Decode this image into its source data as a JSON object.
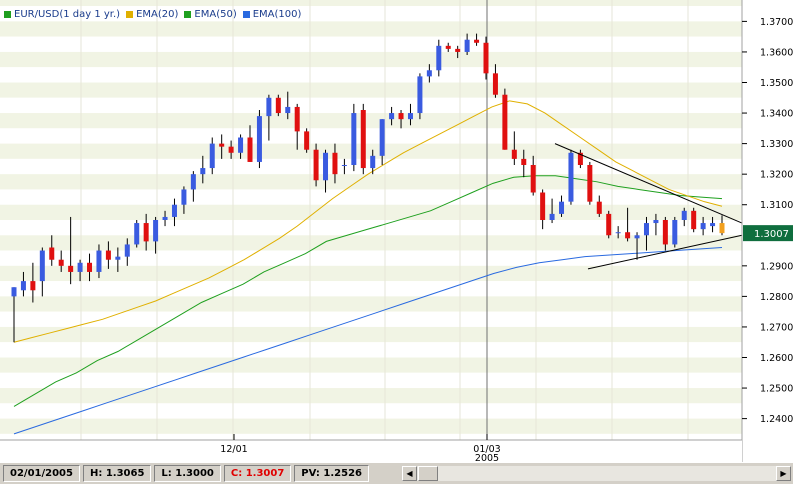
{
  "legend": [
    {
      "label": "EUR/USD(1 day  1 yr.)",
      "color": "#1f9e1f"
    },
    {
      "label": "EMA(20)",
      "color": "#e0b000"
    },
    {
      "label": "EMA(50)",
      "color": "#1fa01f"
    },
    {
      "label": "EMA(100)",
      "color": "#2a6ae0"
    }
  ],
  "price_axis": {
    "labels": [
      "1.3700",
      "1.3600",
      "1.3500",
      "1.3400",
      "1.3300",
      "1.3200",
      "1.3100",
      "1.2900",
      "1.2800",
      "1.2700",
      "1.2600",
      "1.2500",
      "1.2400"
    ],
    "current_price": "1.3007"
  },
  "date_axis": {
    "labels": [
      {
        "text": "12/01",
        "sub": ""
      },
      {
        "text": "01/03",
        "sub": "2005"
      }
    ]
  },
  "status": {
    "date": "02/01/2005",
    "high": "H: 1.3065",
    "low": "L: 1.3000",
    "close": "C: 1.3007",
    "pv": "PV: 1.2526"
  },
  "colors": {
    "up": "#3a5be0",
    "down": "#e01010",
    "ema20": "#e0b000",
    "ema50": "#1fa01f",
    "ema100": "#2a6ae0",
    "current": "#f2a020"
  },
  "chart_data": {
    "type": "candlestick",
    "ylim": [
      1.233,
      1.377
    ],
    "candles": [
      [
        1.28,
        1.283,
        1.265,
        1.283
      ],
      [
        1.282,
        1.288,
        1.28,
        1.285
      ],
      [
        1.285,
        1.291,
        1.278,
        1.282
      ],
      [
        1.285,
        1.296,
        1.28,
        1.295
      ],
      [
        1.296,
        1.3,
        1.29,
        1.292
      ],
      [
        1.292,
        1.295,
        1.288,
        1.29
      ],
      [
        1.29,
        1.306,
        1.284,
        1.288
      ],
      [
        1.288,
        1.292,
        1.285,
        1.291
      ],
      [
        1.291,
        1.294,
        1.285,
        1.288
      ],
      [
        1.288,
        1.297,
        1.286,
        1.295
      ],
      [
        1.295,
        1.298,
        1.289,
        1.292
      ],
      [
        1.292,
        1.296,
        1.288,
        1.293
      ],
      [
        1.293,
        1.299,
        1.29,
        1.297
      ],
      [
        1.297,
        1.305,
        1.296,
        1.304
      ],
      [
        1.304,
        1.307,
        1.295,
        1.298
      ],
      [
        1.298,
        1.306,
        1.294,
        1.305
      ],
      [
        1.305,
        1.308,
        1.303,
        1.306
      ],
      [
        1.306,
        1.312,
        1.303,
        1.31
      ],
      [
        1.31,
        1.316,
        1.307,
        1.315
      ],
      [
        1.315,
        1.321,
        1.311,
        1.32
      ],
      [
        1.32,
        1.326,
        1.317,
        1.322
      ],
      [
        1.322,
        1.332,
        1.32,
        1.33
      ],
      [
        1.33,
        1.333,
        1.325,
        1.329
      ],
      [
        1.329,
        1.331,
        1.325,
        1.327
      ],
      [
        1.327,
        1.333,
        1.325,
        1.332
      ],
      [
        1.332,
        1.336,
        1.324,
        1.324
      ],
      [
        1.324,
        1.341,
        1.322,
        1.339
      ],
      [
        1.339,
        1.346,
        1.331,
        1.345
      ],
      [
        1.345,
        1.346,
        1.339,
        1.34
      ],
      [
        1.34,
        1.347,
        1.338,
        1.342
      ],
      [
        1.342,
        1.343,
        1.328,
        1.334
      ],
      [
        1.334,
        1.335,
        1.327,
        1.328
      ],
      [
        1.328,
        1.33,
        1.316,
        1.318
      ],
      [
        1.318,
        1.328,
        1.314,
        1.327
      ],
      [
        1.327,
        1.33,
        1.317,
        1.32
      ],
      [
        1.323,
        1.325,
        1.32,
        1.323
      ],
      [
        1.323,
        1.343,
        1.321,
        1.34
      ],
      [
        1.341,
        1.343,
        1.32,
        1.322
      ],
      [
        1.322,
        1.328,
        1.32,
        1.326
      ],
      [
        1.326,
        1.338,
        1.323,
        1.338
      ],
      [
        1.338,
        1.342,
        1.336,
        1.34
      ],
      [
        1.34,
        1.341,
        1.335,
        1.338
      ],
      [
        1.338,
        1.343,
        1.336,
        1.34
      ],
      [
        1.34,
        1.353,
        1.338,
        1.352
      ],
      [
        1.352,
        1.356,
        1.35,
        1.354
      ],
      [
        1.354,
        1.364,
        1.352,
        1.362
      ],
      [
        1.362,
        1.363,
        1.36,
        1.361
      ],
      [
        1.361,
        1.362,
        1.358,
        1.36
      ],
      [
        1.36,
        1.366,
        1.359,
        1.364
      ],
      [
        1.364,
        1.366,
        1.362,
        1.363
      ],
      [
        1.363,
        1.365,
        1.351,
        1.353
      ],
      [
        1.353,
        1.356,
        1.345,
        1.346
      ],
      [
        1.346,
        1.348,
        1.328,
        1.328
      ],
      [
        1.328,
        1.334,
        1.323,
        1.325
      ],
      [
        1.325,
        1.328,
        1.319,
        1.323
      ],
      [
        1.323,
        1.326,
        1.313,
        1.314
      ],
      [
        1.314,
        1.315,
        1.302,
        1.305
      ],
      [
        1.305,
        1.312,
        1.304,
        1.307
      ],
      [
        1.307,
        1.313,
        1.306,
        1.311
      ],
      [
        1.311,
        1.328,
        1.31,
        1.327
      ],
      [
        1.327,
        1.328,
        1.322,
        1.323
      ],
      [
        1.323,
        1.324,
        1.31,
        1.311
      ],
      [
        1.311,
        1.313,
        1.306,
        1.307
      ],
      [
        1.307,
        1.308,
        1.299,
        1.3
      ],
      [
        1.301,
        1.303,
        1.299,
        1.301
      ],
      [
        1.301,
        1.309,
        1.298,
        1.299
      ],
      [
        1.299,
        1.301,
        1.292,
        1.3
      ],
      [
        1.3,
        1.306,
        1.295,
        1.304
      ],
      [
        1.304,
        1.307,
        1.3,
        1.305
      ],
      [
        1.305,
        1.306,
        1.295,
        1.297
      ],
      [
        1.297,
        1.306,
        1.296,
        1.305
      ],
      [
        1.305,
        1.309,
        1.303,
        1.308
      ],
      [
        1.308,
        1.309,
        1.301,
        1.302
      ],
      [
        1.302,
        1.306,
        1.3,
        1.304
      ],
      [
        1.303,
        1.306,
        1.301,
        1.304
      ],
      [
        1.304,
        1.3065,
        1.3,
        1.3007
      ]
    ],
    "ema20": [
      1.265,
      1.2665,
      1.268,
      1.2695,
      1.271,
      1.2725,
      1.2745,
      1.2765,
      1.2785,
      1.281,
      1.2835,
      1.286,
      1.289,
      1.292,
      1.2955,
      1.299,
      1.303,
      1.3075,
      1.312,
      1.316,
      1.32,
      1.3235,
      1.327,
      1.33,
      1.333,
      1.336,
      1.339,
      1.342,
      1.344,
      1.343,
      1.34,
      1.336,
      1.332,
      1.328,
      1.324,
      1.321,
      1.318,
      1.315,
      1.313,
      1.311,
      1.3095
    ],
    "ema50": [
      1.244,
      1.248,
      1.252,
      1.255,
      1.259,
      1.262,
      1.266,
      1.27,
      1.274,
      1.278,
      1.281,
      1.284,
      1.288,
      1.291,
      1.294,
      1.298,
      1.3,
      1.302,
      1.304,
      1.306,
      1.308,
      1.311,
      1.314,
      1.317,
      1.319,
      1.3195,
      1.3195,
      1.3185,
      1.3175,
      1.316,
      1.315,
      1.314,
      1.313,
      1.3125,
      1.312
    ],
    "ema100": [
      1.235,
      1.2375,
      1.24,
      1.2425,
      1.245,
      1.2475,
      1.25,
      1.2525,
      1.255,
      1.2575,
      1.26,
      1.2625,
      1.265,
      1.2675,
      1.27,
      1.2725,
      1.275,
      1.2775,
      1.28,
      1.2825,
      1.285,
      1.2875,
      1.2895,
      1.291,
      1.292,
      1.293,
      1.2935,
      1.294,
      1.2945,
      1.295,
      1.2955,
      1.296
    ],
    "trendlines": [
      {
        "from": [
          1.33
        ],
        "to": [
          1.307
        ]
      },
      {
        "from": [
          1.289
        ],
        "to": [
          1.3
        ]
      }
    ]
  }
}
